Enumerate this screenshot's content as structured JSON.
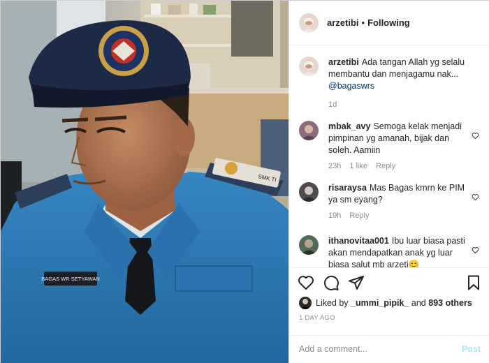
{
  "post": {
    "photo_alt": "photo",
    "name_tag": "BAGAS WR SETYAWAN",
    "shoulder_tag": "SMK TI"
  },
  "header": {
    "username": "arzetibi",
    "separator": "•",
    "follow_status": "Following"
  },
  "comments": [
    {
      "username": "arzetibi",
      "text": "Ada tangan Allah yg selalu membantu dan menjagamu nak...",
      "mention": "@bagaswrs",
      "time": "1d",
      "likes": "",
      "reply": ""
    },
    {
      "username": "mbak_avy",
      "text": "Semoga kelak menjadi pimpinan yg amanah, bijak dan soleh. Aamiin",
      "mention": "",
      "time": "23h",
      "likes": "1 like",
      "reply": "Reply"
    },
    {
      "username": "risaraysa",
      "text": "Mas Bagas kmrn ke PIM ya sm eyang?",
      "mention": "",
      "time": "19h",
      "likes": "",
      "reply": "Reply"
    },
    {
      "username": "ithanovitaa001",
      "text": "Ibu luar biasa pasti akan mendapatkan anak yg luar biasa salut mb arzeti😊",
      "mention": "",
      "time": "",
      "likes": "",
      "reply": ""
    }
  ],
  "likes": {
    "prefix": "Liked by",
    "user": "_ummi_pipik_",
    "middle": "and",
    "count": "893 others"
  },
  "timestamp": "1 DAY AGO",
  "add_comment": {
    "placeholder": "Add a comment...",
    "post_label": "Post"
  },
  "icons": {
    "like": "heart-icon",
    "comment": "comment-icon",
    "share": "paper-plane-icon",
    "save": "bookmark-icon"
  },
  "colors": {
    "link": "#00376b",
    "meta": "#8e8e8e",
    "post_disabled": "#b2dffc",
    "uniform": "#2f79b4",
    "beret": "#1c2a45"
  }
}
